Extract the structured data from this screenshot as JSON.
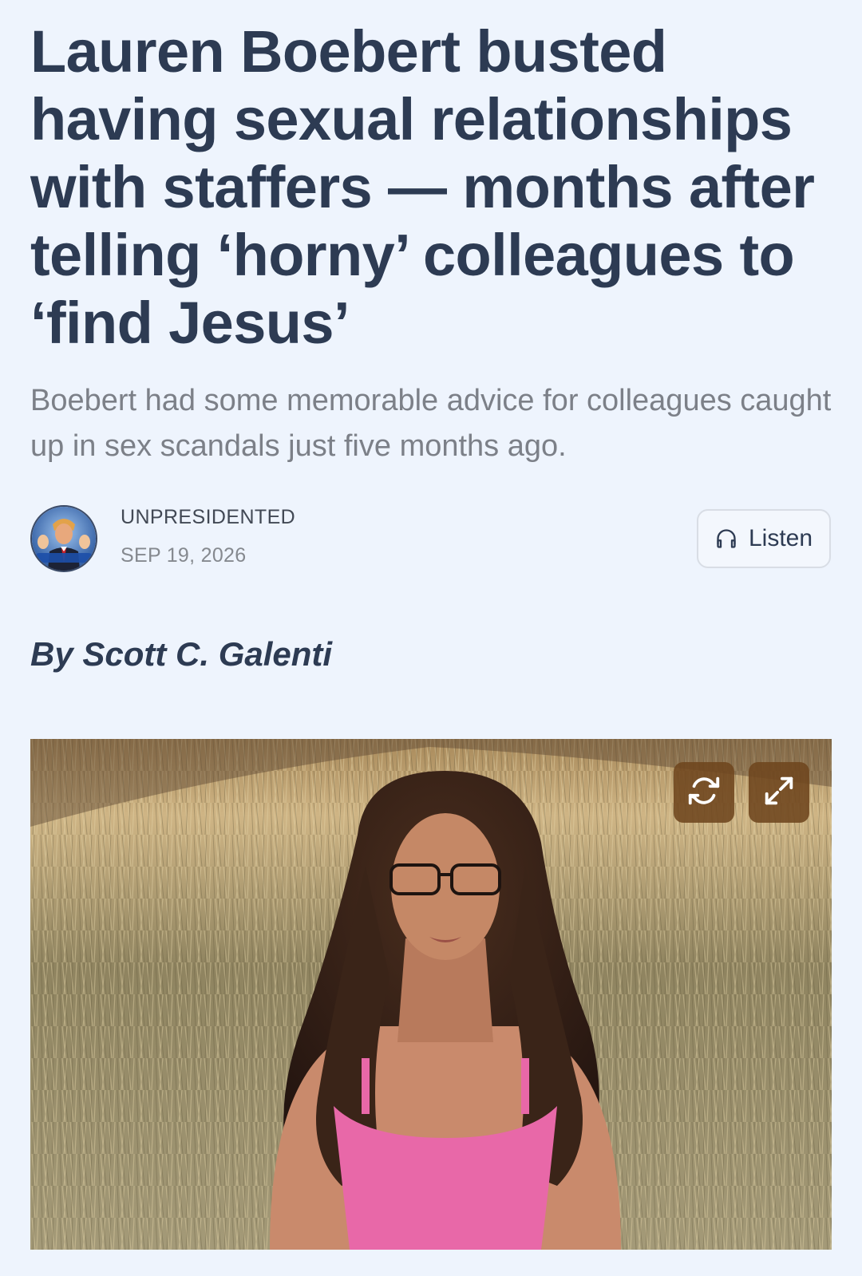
{
  "article": {
    "headline": "Lauren Boebert busted having sexual relationships with staffers — months after telling ‘horny’ colleagues to ‘find Jesus’",
    "subtitle": "Boebert had some memorable advice for colleagues caught up in sex scandals just five months ago.",
    "byline": "By Scott C. Galenti"
  },
  "publication": {
    "name": "UNPRESIDENTED",
    "date": "SEP 19, 2026",
    "avatar_text": "UnPresidented"
  },
  "listen": {
    "label": "Listen",
    "icon": "headphones-icon"
  },
  "photo": {
    "controls": [
      "refresh-icon",
      "expand-icon"
    ],
    "button_color": "#6e461e"
  },
  "colors": {
    "background": "#eef4fd",
    "headline": "#2d3b53",
    "subtitle": "#7c8088"
  }
}
